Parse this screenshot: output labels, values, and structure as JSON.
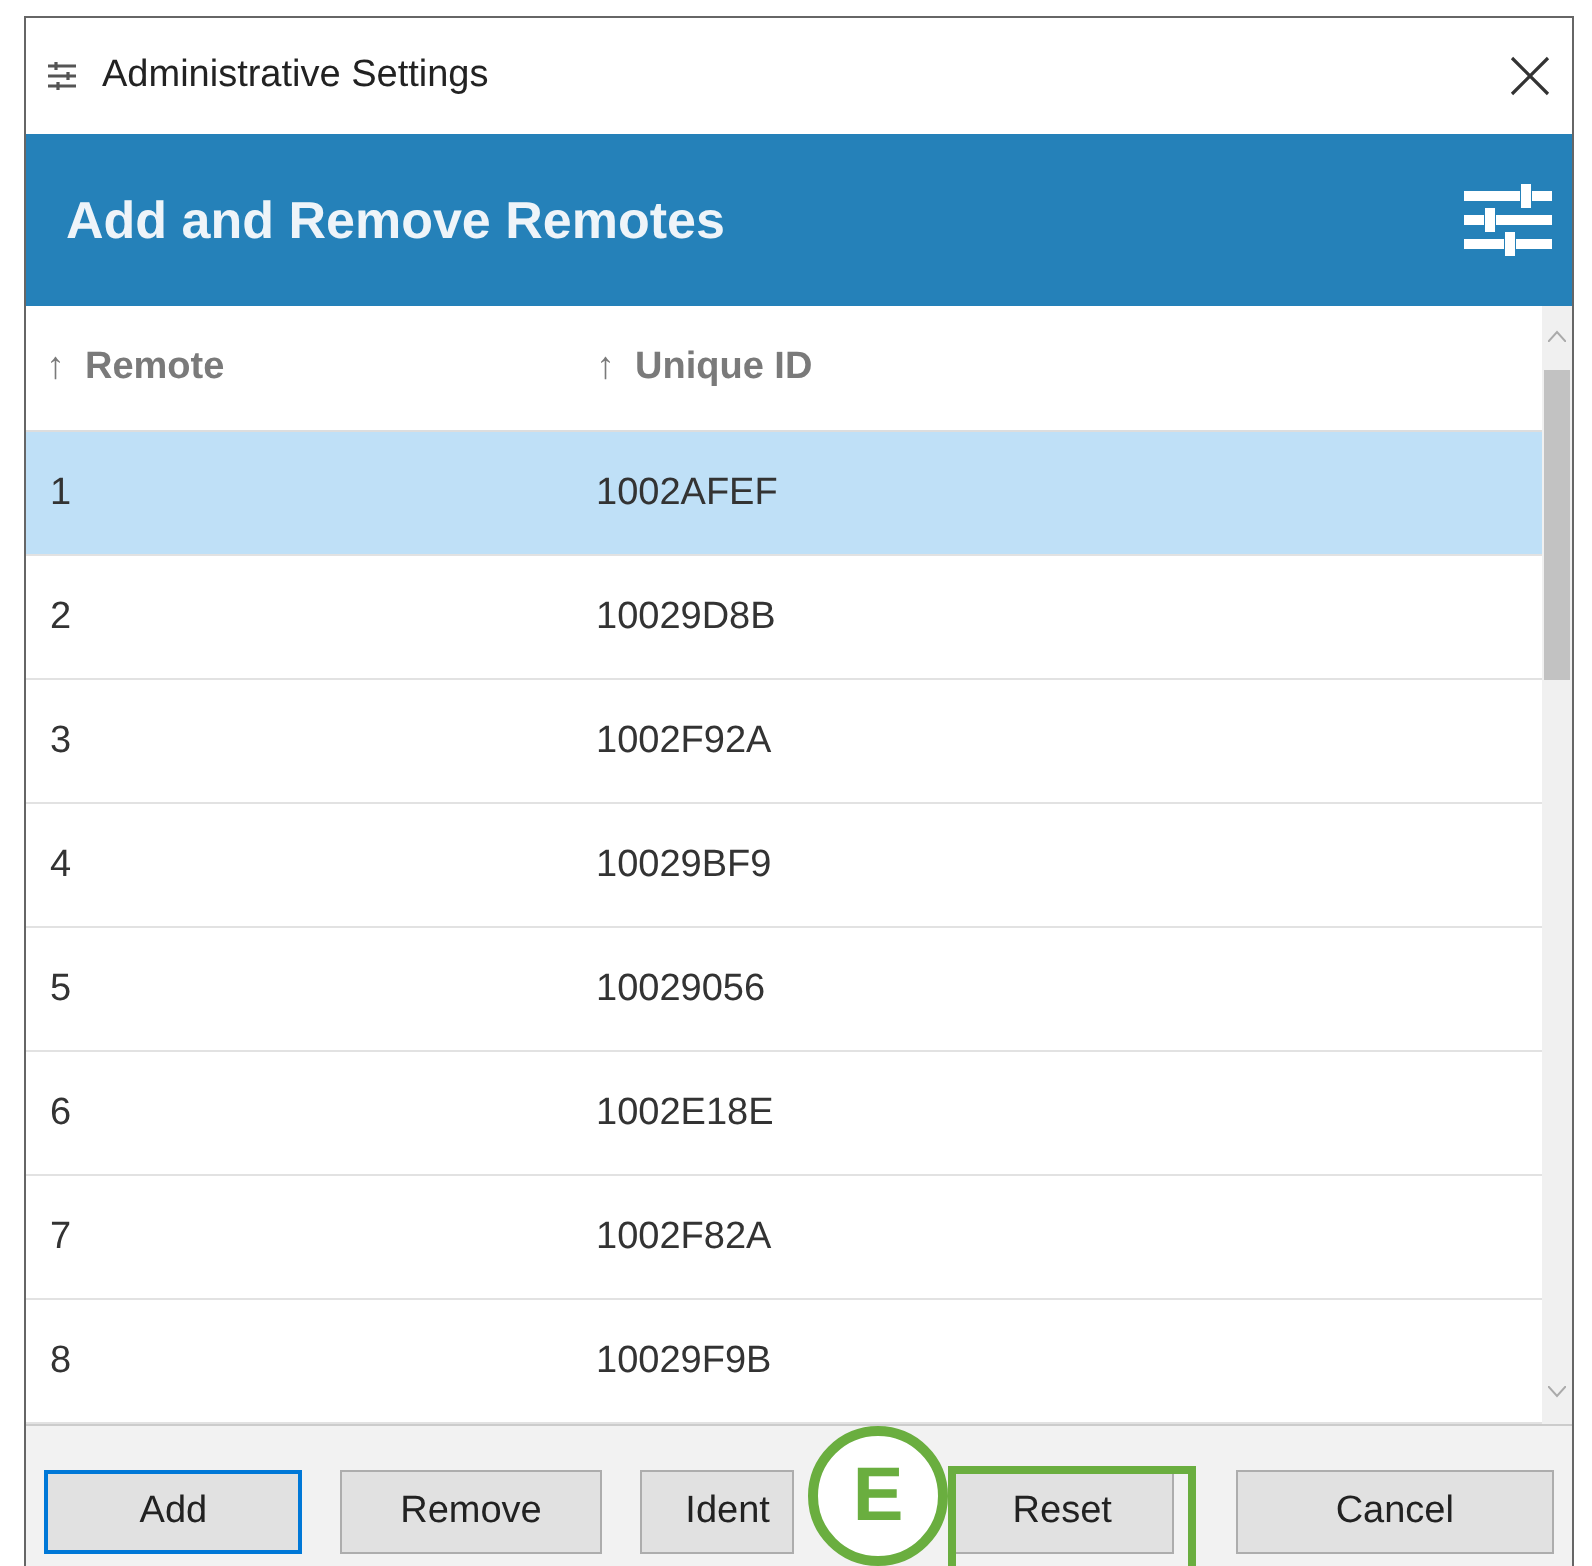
{
  "window": {
    "title": "Administrative Settings"
  },
  "header": {
    "title": "Add and Remove Remotes"
  },
  "table": {
    "columns": [
      {
        "label": "Remote",
        "sort_arrow": "↑"
      },
      {
        "label": "Unique ID",
        "sort_arrow": "↑"
      }
    ],
    "rows": [
      {
        "remote": "1",
        "unique_id": "1002AFEF",
        "selected": true
      },
      {
        "remote": "2",
        "unique_id": "10029D8B",
        "selected": false
      },
      {
        "remote": "3",
        "unique_id": "1002F92A",
        "selected": false
      },
      {
        "remote": "4",
        "unique_id": "10029BF9",
        "selected": false
      },
      {
        "remote": "5",
        "unique_id": "10029056",
        "selected": false
      },
      {
        "remote": "6",
        "unique_id": "1002E18E",
        "selected": false
      },
      {
        "remote": "7",
        "unique_id": "1002F82A",
        "selected": false
      },
      {
        "remote": "8",
        "unique_id": "10029F9B",
        "selected": false
      }
    ]
  },
  "buttons": [
    {
      "label": "Add",
      "focused": true
    },
    {
      "label": "Remove",
      "focused": false
    },
    {
      "label": "Ident",
      "focused": false
    },
    {
      "label": "Reset",
      "focused": false
    },
    {
      "label": "Cancel",
      "focused": false
    }
  ],
  "callout": {
    "letter": "E"
  }
}
